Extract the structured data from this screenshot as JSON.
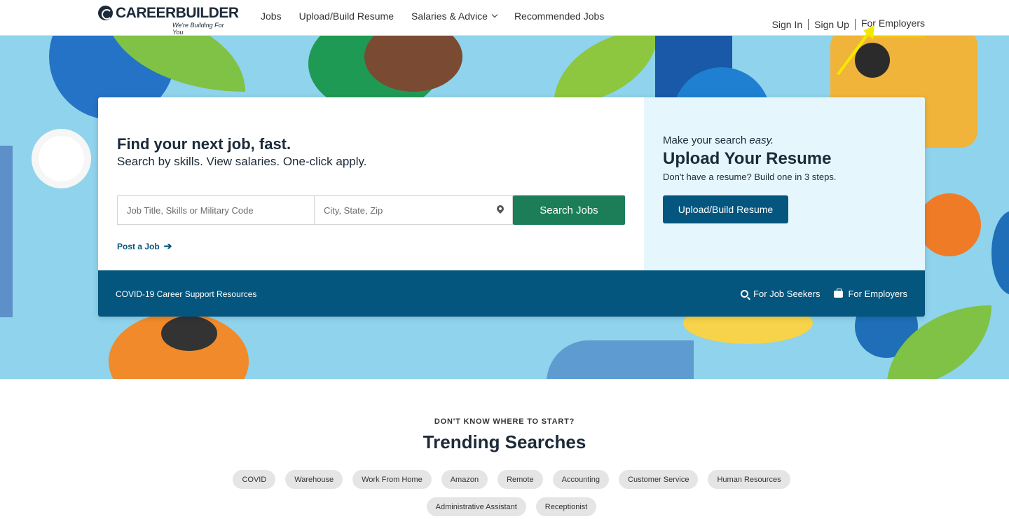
{
  "brand": {
    "name": "CAREERBUILDER",
    "tagline": "We're Building For You"
  },
  "nav": [
    {
      "label": "Jobs"
    },
    {
      "label": "Upload/Build Resume"
    },
    {
      "label": "Salaries & Advice"
    },
    {
      "label": "Recommended Jobs"
    }
  ],
  "auth": {
    "sign_in": "Sign In",
    "sign_up": "Sign Up",
    "employers": "For Employers"
  },
  "hero": {
    "headline": "Find your next job, fast.",
    "subheadline": "Search by skills. View salaries. One-click apply.",
    "job_placeholder": "Job Title, Skills or Military Code",
    "location_placeholder": "City, State, Zip",
    "search_button": "Search Jobs",
    "post_job": "Post a Job",
    "right_kicker_prefix": "Make your search ",
    "right_kicker_em": "easy.",
    "right_title": "Upload Your Resume",
    "right_sub": "Don't have a resume? Build one in 3 steps.",
    "upload_button": "Upload/Build Resume",
    "covid_link": "COVID-19 Career Support Resources",
    "job_seekers": "For Job Seekers",
    "for_employers": "For Employers"
  },
  "trending": {
    "kicker": "DON'T KNOW WHERE TO START?",
    "title": "Trending Searches",
    "row1": [
      "COVID",
      "Warehouse",
      "Work From Home",
      "Amazon",
      "Remote",
      "Accounting",
      "Customer Service",
      "Human Resources"
    ],
    "row2": [
      "Administrative Assistant",
      "Receptionist"
    ]
  },
  "colors": {
    "brand_navy": "#05567e",
    "search_green": "#1b7e58",
    "hero_bg": "#8fd3ec",
    "annotation_arrow": "#f5e800"
  }
}
